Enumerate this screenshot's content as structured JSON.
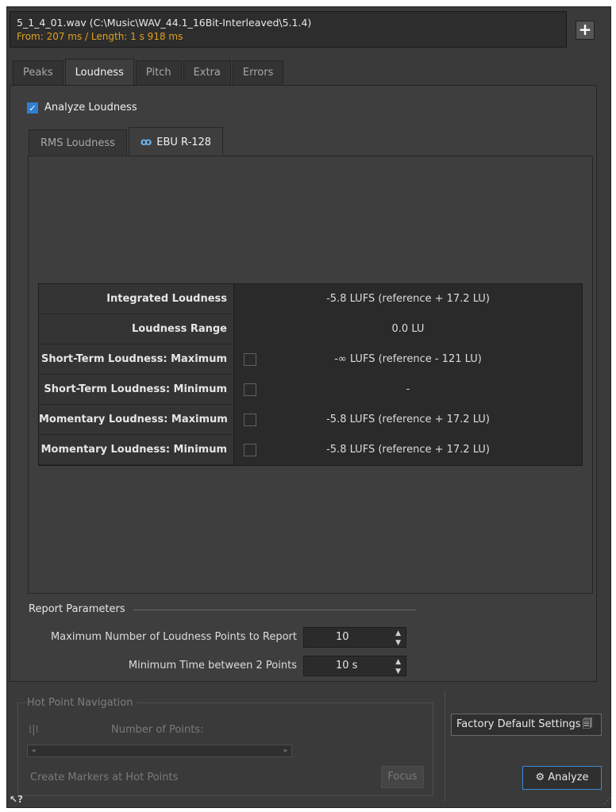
{
  "file": {
    "path_line": "5_1_4_01.wav (C:\\Music\\WAV_44.1_16Bit-Interleaved\\5.1.4)",
    "range_line": "From: 207 ms / Length: 1 s 918 ms",
    "add_label": "+"
  },
  "tabs": [
    {
      "label": "Peaks"
    },
    {
      "label": "Loudness"
    },
    {
      "label": "Pitch"
    },
    {
      "label": "Extra"
    },
    {
      "label": "Errors"
    }
  ],
  "analyze_loudness": {
    "label": "Analyze Loudness",
    "checked": true
  },
  "subtabs": [
    {
      "label": "RMS Loudness"
    },
    {
      "label": "EBU R-128",
      "icon": "ebu-icon"
    }
  ],
  "loudness_table": [
    {
      "label": "Integrated Loudness",
      "has_checkbox": false,
      "value": "-5.8 LUFS (reference + 17.2 LU)"
    },
    {
      "label": "Loudness Range",
      "has_checkbox": false,
      "value": "0.0 LU"
    },
    {
      "label": "Short-Term Loudness: Maximum",
      "has_checkbox": true,
      "value": "-∞ LUFS (reference - 121 LU)"
    },
    {
      "label": "Short-Term Loudness: Minimum",
      "has_checkbox": true,
      "value": "-"
    },
    {
      "label": "Momentary Loudness: Maximum",
      "has_checkbox": true,
      "value": "-5.8 LUFS (reference + 17.2 LU)"
    },
    {
      "label": "Momentary Loudness: Minimum",
      "has_checkbox": true,
      "value": "-5.8 LUFS (reference + 17.2 LU)"
    }
  ],
  "report": {
    "title": "Report Parameters",
    "max_points_label": "Maximum Number of Loudness Points to Report",
    "max_points_value": "10",
    "min_time_label": "Minimum Time between 2 Points",
    "min_time_value": "10 s"
  },
  "hot_points": {
    "title": "Hot Point Navigation",
    "number_label": "Number of Points:",
    "markers_label": "Create Markers at Hot Points",
    "focus_label": "Focus"
  },
  "buttons": {
    "factory_default": "Factory Default Settings",
    "analyze": "Analyze"
  },
  "colors": {
    "accent": "#2f7fd0",
    "warning_text": "#e0a020"
  }
}
